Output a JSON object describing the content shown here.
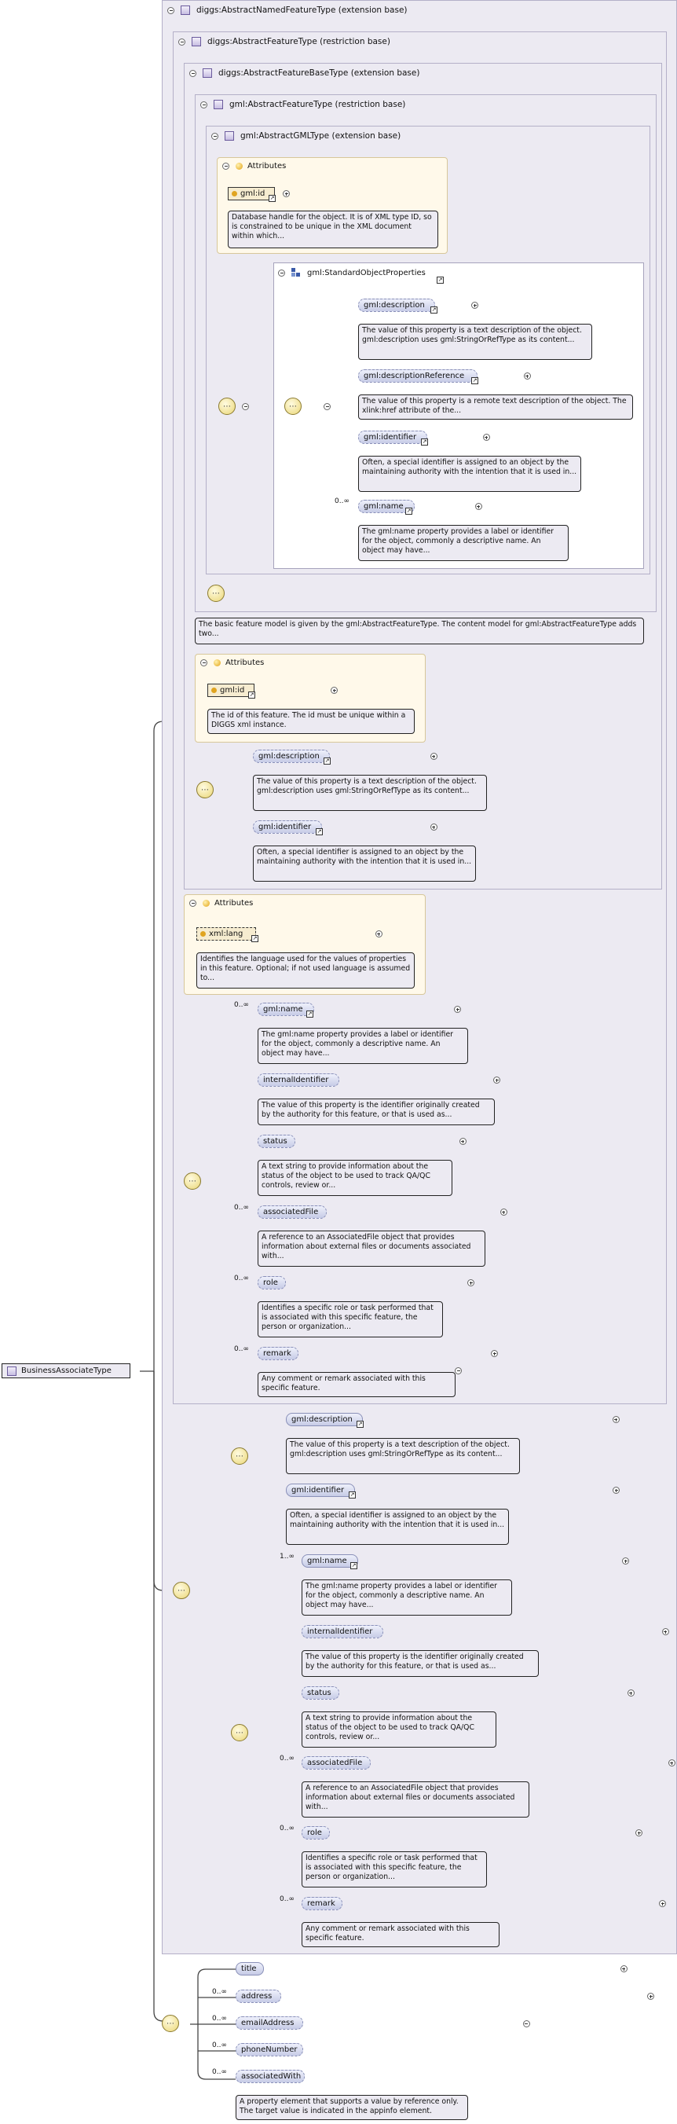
{
  "root": {
    "name": "BusinessAssociateType"
  },
  "types": [
    {
      "label": "diggs:AbstractNamedFeatureType (extension base)"
    },
    {
      "label": "diggs:AbstractFeatureType (restriction base)"
    },
    {
      "label": "diggs:AbstractFeatureBaseType (extension base)"
    },
    {
      "label": "gml:AbstractFeatureType (restriction base)"
    },
    {
      "label": "gml:AbstractGMLType (extension base)"
    }
  ],
  "attributes_label": "Attributes",
  "gml_id_1": {
    "name": "gml:id",
    "doc": "Database handle for the object. It is of XML type ID, so is constrained to be unique in the XML document within which..."
  },
  "standard_group": {
    "label": "gml:StandardObjectProperties"
  },
  "std": {
    "description": {
      "name": "gml:description",
      "doc": "The value of this property is a text description of the object. gml:description uses gml:StringOrRefType as its content..."
    },
    "descriptionReference": {
      "name": "gml:descriptionReference",
      "doc": "The value of this property is a remote text description of the object. The xlink:href attribute of the..."
    },
    "identifier": {
      "name": "gml:identifier",
      "doc": "Often, a special identifier is assigned to an object by the maintaining authority with the intention that it is used in..."
    },
    "name": {
      "name": "gml:name",
      "card": "0..∞",
      "doc": "The gml:name property provides a label or identifier for the object, commonly a descriptive name. An object may have..."
    }
  },
  "feature_doc": "The basic feature model is given by the gml:AbstractFeatureType. The content model for gml:AbstractFeatureType adds two...",
  "gml_id_2": {
    "name": "gml:id",
    "doc": "The id of this feature. The id must be unique within a DIGGS xml instance."
  },
  "afb": {
    "description": {
      "name": "gml:description",
      "doc": "The value of this property is a text description of the object. gml:description uses gml:StringOrRefType as its content..."
    },
    "identifier": {
      "name": "gml:identifier",
      "doc": "Often, a special identifier is assigned to an object by the maintaining authority with the intention that it is used in..."
    }
  },
  "xml_lang": {
    "name": "xml:lang",
    "doc": "Identifies the language used for the values of properties in this feature. Optional; if not used language is assumed to..."
  },
  "named": {
    "name": {
      "name": "gml:name",
      "card": "0..∞",
      "doc": "The gml:name property provides a label or identifier for the object, commonly a descriptive name. An object may have..."
    },
    "internalIdentifier": {
      "name": "internalIdentifier",
      "doc": "The value of this property is the identifier originally created by the authority for this feature, or that is used as..."
    },
    "status": {
      "name": "status",
      "doc": "A text string to provide information about the status of the object to be used to track QA/QC controls, review or..."
    },
    "associatedFile": {
      "name": "associatedFile",
      "card": "0..∞",
      "doc": "A reference to an AssociatedFile object that provides information about external files or documents associated with..."
    },
    "role": {
      "name": "role",
      "card": "0..∞",
      "doc": "Identifies a specific role or task performed that is associated with this specific feature, the person or organization..."
    },
    "remark": {
      "name": "remark",
      "card": "0..∞",
      "doc": "Any comment or remark associated with this specific feature."
    }
  },
  "choice": {
    "description": {
      "name": "gml:description",
      "doc": "The value of this property is a text description of the object. gml:description uses gml:StringOrRefType as its content..."
    },
    "identifier": {
      "name": "gml:identifier",
      "doc": "Often, a special identifier is assigned to an object by the maintaining authority with the intention that it is used in..."
    },
    "name": {
      "name": "gml:name",
      "card": "1..∞",
      "doc": "The gml:name property provides a label or identifier for the object, commonly a descriptive name. An object may have..."
    },
    "internalIdentifier": {
      "name": "internalIdentifier",
      "doc": "The value of this property is the identifier originally created by the authority for this feature, or that is used as..."
    },
    "status": {
      "name": "status",
      "doc": "A text string to provide information about the status of the object to be used to track QA/QC controls, review or..."
    },
    "associatedFile": {
      "name": "associatedFile",
      "card": "0..∞",
      "doc": "A reference to an AssociatedFile object that provides information about external files or documents associated with..."
    },
    "role": {
      "name": "role",
      "card": "0..∞",
      "doc": "Identifies a specific role or task performed that is associated with this specific feature, the person or organization..."
    },
    "remark": {
      "name": "remark",
      "card": "0..∞",
      "doc": "Any comment or remark associated with this specific feature."
    }
  },
  "own": {
    "title": {
      "name": "title"
    },
    "address": {
      "name": "address",
      "card": "0..∞"
    },
    "emailAddress": {
      "name": "emailAddress",
      "card": "0..∞"
    },
    "phoneNumber": {
      "name": "phoneNumber",
      "card": "0..∞"
    },
    "associatedWith": {
      "name": "associatedWith",
      "card": "0..∞",
      "doc": "A property element that supports a value by reference only. The target value is indicated in the appinfo element."
    }
  }
}
